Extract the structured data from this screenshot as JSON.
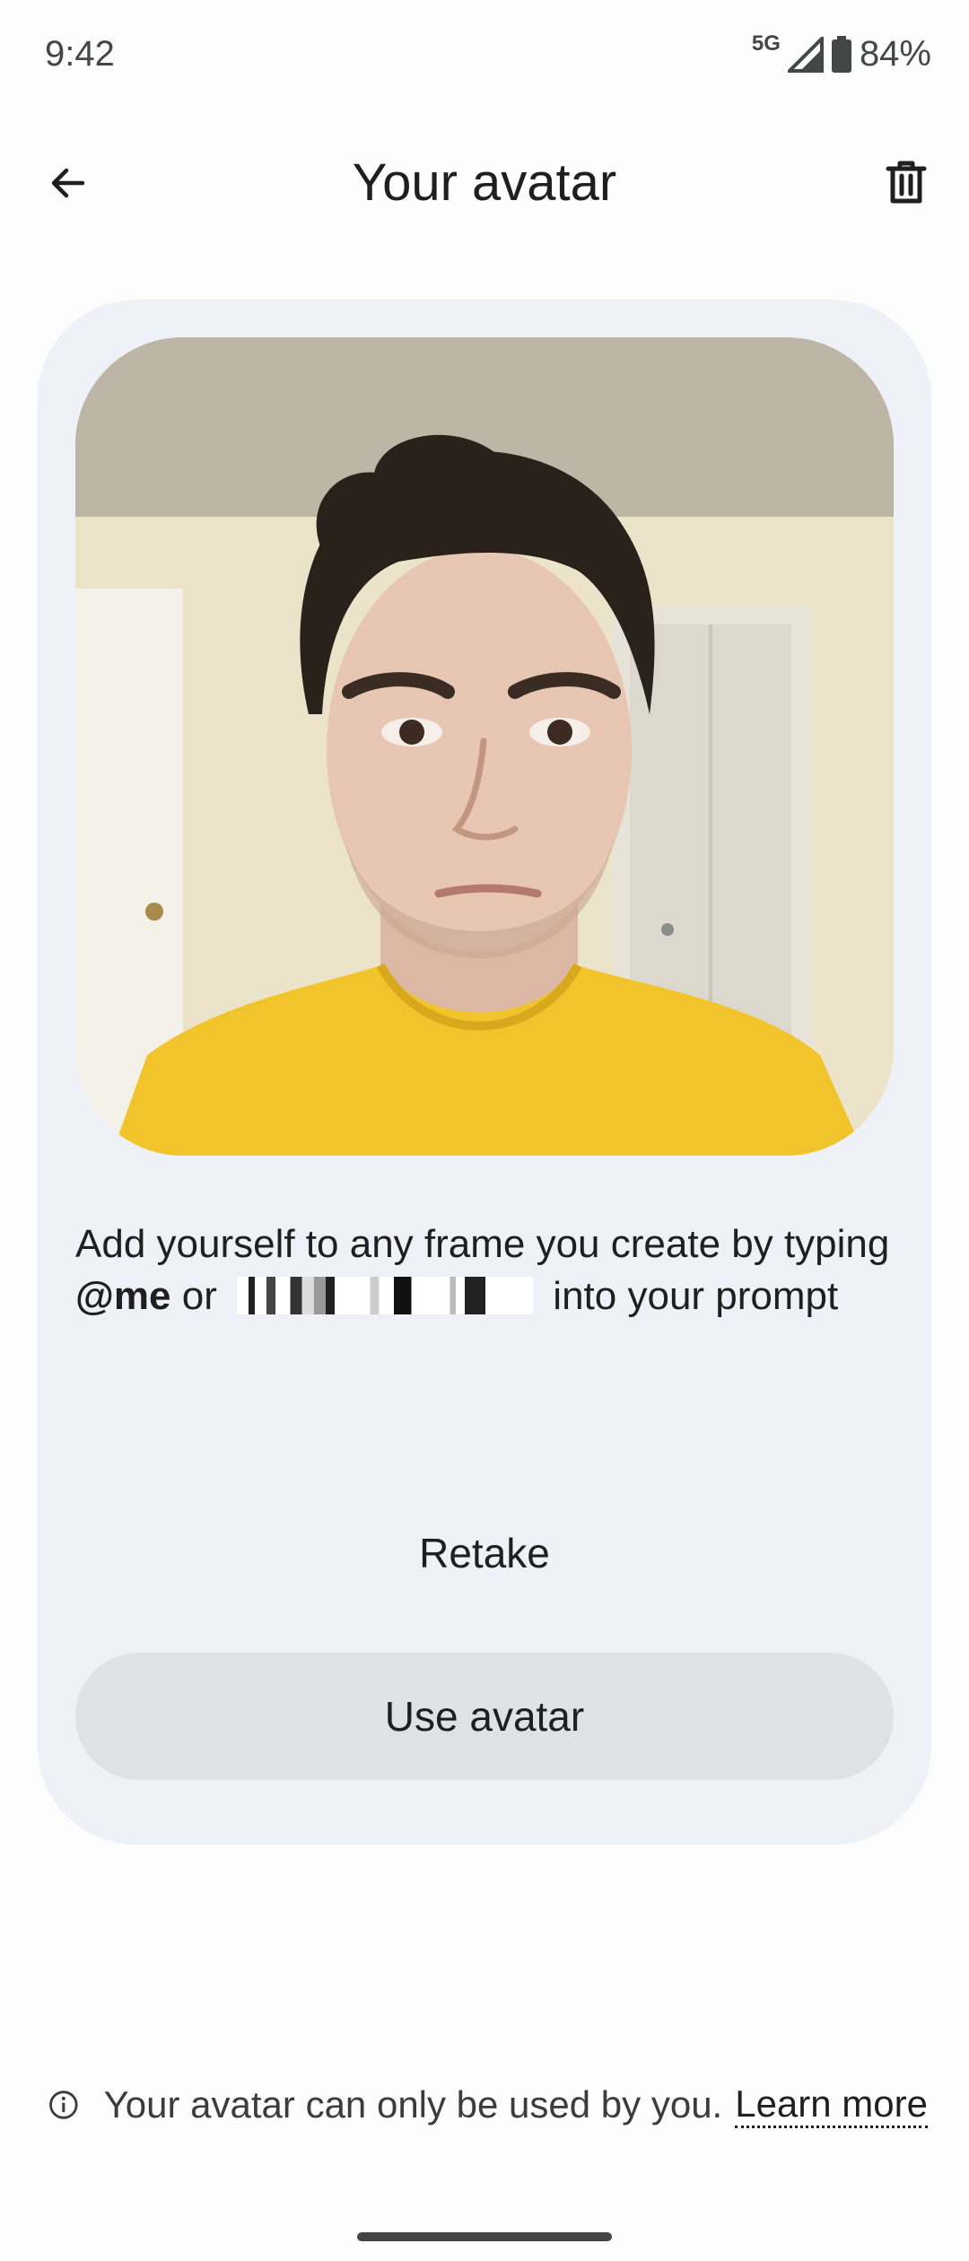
{
  "status_bar": {
    "time": "9:42",
    "network": "5G",
    "battery": "84%"
  },
  "app_bar": {
    "title": "Your avatar",
    "back_icon": "arrow-back-icon",
    "delete_icon": "trash-icon"
  },
  "card": {
    "photo": "avatar-photo",
    "description_pre": "Add yourself to any frame you create by typing ",
    "description_handle": "@me",
    "description_mid": " or ",
    "description_post": " into your prompt",
    "retake_label": "Retake",
    "use_label": "Use avatar"
  },
  "footer": {
    "info_icon": "info-icon",
    "text": "Your avatar can only be used by you.",
    "link": "Learn more"
  },
  "colors": {
    "card_bg": "#eef1f7",
    "button_bg": "#dfe1e6",
    "shirt": "#f2c42c"
  }
}
